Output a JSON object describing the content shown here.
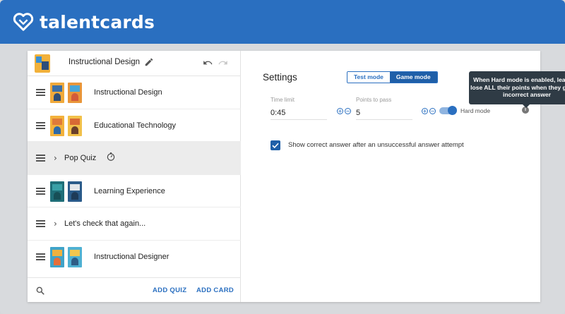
{
  "app": {
    "brand": "talentcards"
  },
  "deck": {
    "title": "Instructional Design"
  },
  "items": [
    {
      "type": "set",
      "label": "Instructional Design"
    },
    {
      "type": "set",
      "label": "Educational Technology"
    },
    {
      "type": "quiz",
      "label": "Pop Quiz",
      "selected": true
    },
    {
      "type": "set",
      "label": "Learning Experience"
    },
    {
      "type": "quiz",
      "label": "Let's check that again..."
    },
    {
      "type": "set",
      "label": "Instructional Designer"
    }
  ],
  "footer": {
    "add_quiz": "ADD QUIZ",
    "add_card": "ADD CARD"
  },
  "settings": {
    "title": "Settings",
    "modes": [
      "Test mode",
      "Game mode"
    ],
    "active_mode": "Game mode",
    "time_limit_label": "Time limit",
    "time_limit_value": "0:45",
    "points_label": "Points to pass",
    "points_value": "5",
    "hard_mode_label": "Hard mode",
    "hard_mode_enabled": true,
    "tooltip": "When Hard mode is enabled, learners lose ALL their points when they give an incorrect answer",
    "show_answer_label": "Show correct answer after an unsuccessful answer attempt",
    "show_answer_checked": true
  },
  "colors": {
    "brand": "#2a6fc0",
    "tooltip_bg": "#2f3b45"
  }
}
